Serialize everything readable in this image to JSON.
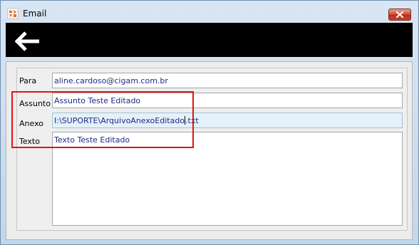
{
  "window": {
    "title": "Email",
    "app_icon": "cigam-logo-icon",
    "close_icon": "close-icon"
  },
  "toolbar": {
    "back_icon": "back-arrow-icon"
  },
  "form": {
    "para_label": "Para",
    "para_value": "aline.cardoso@cigam.com.br",
    "assunto_label": "Assunto",
    "assunto_value": "Assunto Teste Editado",
    "anexo_label": "Anexo",
    "anexo_value_before_caret": "I:\\SUPORTE\\ArquivoAnexoEditado",
    "anexo_value_after_caret": ".txt",
    "texto_label": "Texto",
    "texto_value": "Texto Teste Editado"
  },
  "colors": {
    "toolbar_bg": "#000000",
    "field_text": "#1d2b86",
    "highlight_border": "#e11414",
    "active_field_bg": "#e5f1fa"
  }
}
